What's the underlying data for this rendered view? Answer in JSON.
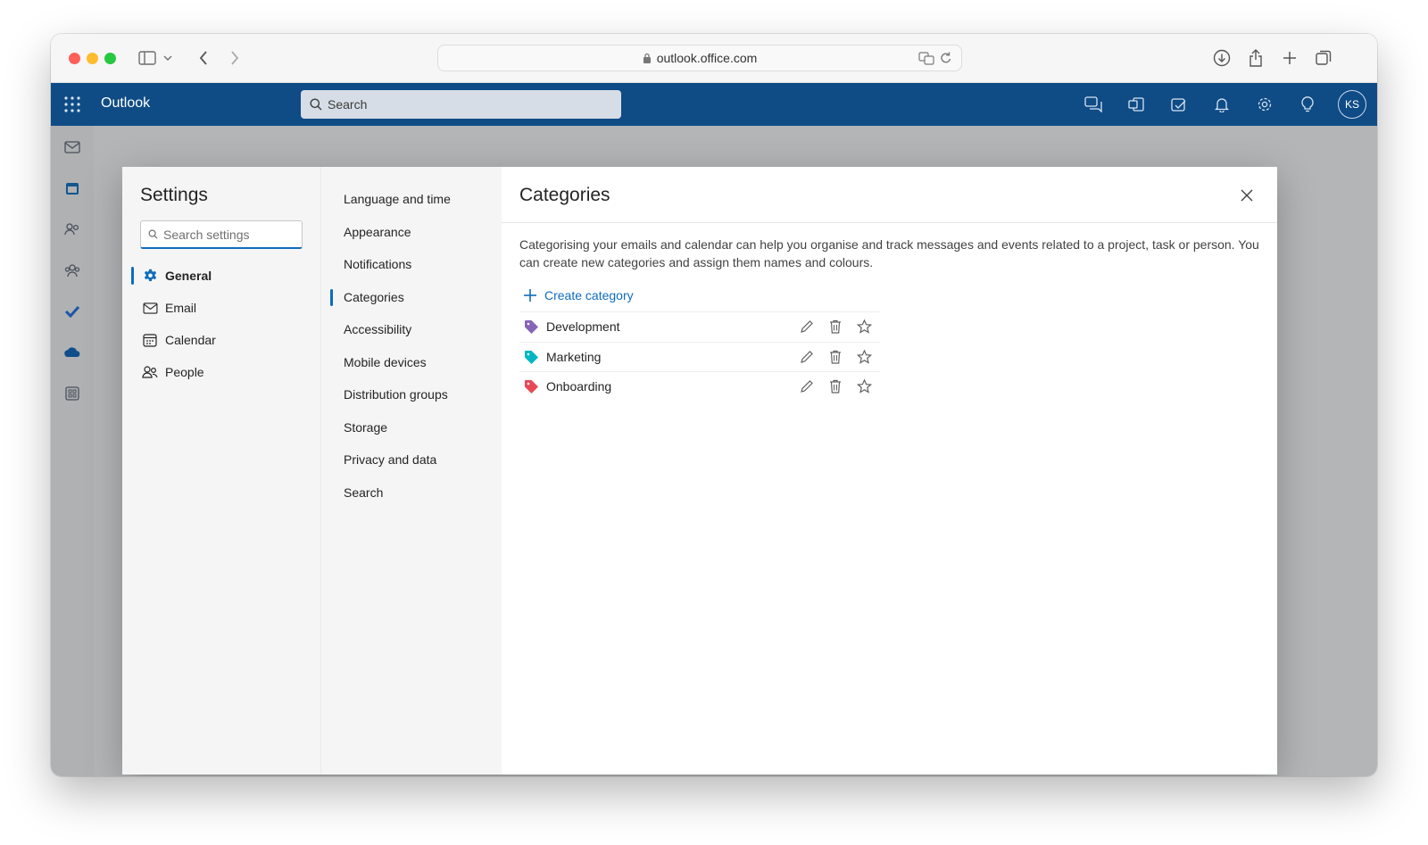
{
  "browser": {
    "url": "outlook.office.com"
  },
  "app": {
    "brand": "Outlook",
    "search_placeholder": "Search",
    "avatar_initials": "KS"
  },
  "settings": {
    "title": "Settings",
    "search_placeholder": "Search settings",
    "primary_nav": [
      {
        "label": "General",
        "icon": "gear-icon",
        "active": true
      },
      {
        "label": "Email",
        "icon": "mail-icon",
        "active": false
      },
      {
        "label": "Calendar",
        "icon": "calendar-icon",
        "active": false
      },
      {
        "label": "People",
        "icon": "people-icon",
        "active": false
      }
    ],
    "secondary_nav": [
      {
        "label": "Language and time",
        "active": false
      },
      {
        "label": "Appearance",
        "active": false
      },
      {
        "label": "Notifications",
        "active": false
      },
      {
        "label": "Categories",
        "active": true
      },
      {
        "label": "Accessibility",
        "active": false
      },
      {
        "label": "Mobile devices",
        "active": false
      },
      {
        "label": "Distribution groups",
        "active": false
      },
      {
        "label": "Storage",
        "active": false
      },
      {
        "label": "Privacy and data",
        "active": false
      },
      {
        "label": "Search",
        "active": false
      }
    ]
  },
  "categories": {
    "title": "Categories",
    "description": "Categorising your emails and calendar can help you organise and track messages and events related to a project, task or person. You can create new categories and assign them names and colours.",
    "create_label": "Create category",
    "items": [
      {
        "name": "Development",
        "color": "#8764b8"
      },
      {
        "name": "Marketing",
        "color": "#00b7c3"
      },
      {
        "name": "Onboarding",
        "color": "#e74856"
      }
    ]
  },
  "colors": {
    "accent": "#0f6cbd",
    "appbar": "#0f4c86"
  }
}
